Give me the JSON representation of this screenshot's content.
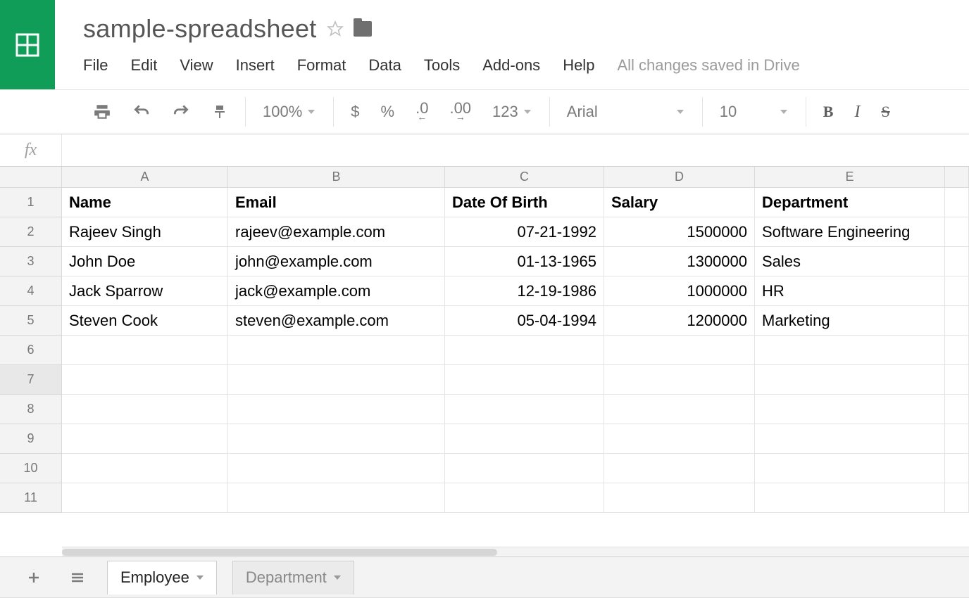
{
  "doc_title": "sample-spreadsheet",
  "menu": {
    "file": "File",
    "edit": "Edit",
    "view": "View",
    "insert": "Insert",
    "format": "Format",
    "data": "Data",
    "tools": "Tools",
    "addons": "Add-ons",
    "help": "Help",
    "save_status": "All changes saved in Drive"
  },
  "toolbar": {
    "zoom": "100%",
    "currency": "$",
    "percent": "%",
    "dec_dec": ".0",
    "inc_dec": ".00",
    "num_format": "123",
    "font": "Arial",
    "font_size": "10",
    "bold": "B",
    "italic": "I",
    "strike": "S"
  },
  "fx": {
    "label": "fx",
    "value": ""
  },
  "columns": [
    "A",
    "B",
    "C",
    "D",
    "E"
  ],
  "row_numbers": [
    "1",
    "2",
    "3",
    "4",
    "5",
    "6",
    "7",
    "8",
    "9",
    "10",
    "11"
  ],
  "selected_row_index": 6,
  "headers": {
    "name": "Name",
    "email": "Email",
    "dob": "Date Of Birth",
    "salary": "Salary",
    "dept": "Department"
  },
  "rows": [
    {
      "name": "Rajeev Singh",
      "email": "rajeev@example.com",
      "dob": "07-21-1992",
      "salary": "1500000",
      "dept": "Software Engineering"
    },
    {
      "name": "John Doe",
      "email": "john@example.com",
      "dob": "01-13-1965",
      "salary": "1300000",
      "dept": "Sales"
    },
    {
      "name": "Jack Sparrow",
      "email": "jack@example.com",
      "dob": "12-19-1986",
      "salary": "1000000",
      "dept": "HR"
    },
    {
      "name": "Steven Cook",
      "email": "steven@example.com",
      "dob": "05-04-1994",
      "salary": "1200000",
      "dept": "Marketing"
    }
  ],
  "sheets": {
    "active": "Employee",
    "inactive": "Department"
  }
}
